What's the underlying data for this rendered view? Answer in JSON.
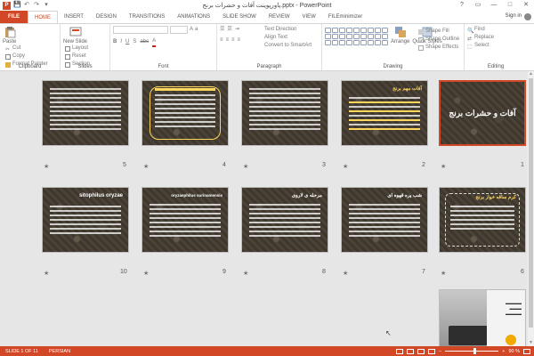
{
  "window": {
    "title": "پاورپوینت آفات و حشرات برنج.pptx - PowerPoint",
    "controls": [
      "?",
      "▭",
      "—",
      "□",
      "✕"
    ]
  },
  "qat": {
    "logo": "P",
    "save": "💾",
    "undo": "↶",
    "redo": "↷",
    "customize": "▾"
  },
  "tabs": [
    "FILE",
    "HOME",
    "INSERT",
    "DESIGN",
    "TRANSITIONS",
    "ANIMATIONS",
    "SLIDE SHOW",
    "REVIEW",
    "VIEW",
    "FILEminimizer"
  ],
  "active_tab": "HOME",
  "signin": "Sign in",
  "ribbon": {
    "clipboard": {
      "label": "Clipboard",
      "paste": "Paste",
      "cut": "Cut",
      "copy": "Copy",
      "format_painter": "Format Painter"
    },
    "slides": {
      "label": "Slides",
      "new_slide": "New Slide",
      "layout": "Layout",
      "reset": "Reset",
      "section": "Section"
    },
    "font": {
      "label": "Font"
    },
    "paragraph": {
      "label": "Paragraph",
      "text_direction": "Text Direction",
      "align_text": "Align Text",
      "convert": "Convert to SmartArt"
    },
    "drawing": {
      "label": "Drawing",
      "arrange": "Arrange",
      "quick_styles": "Quick Styles",
      "shape_fill": "Shape Fill",
      "shape_outline": "Shape Outline",
      "shape_effects": "Shape Effects"
    },
    "editing": {
      "label": "Editing",
      "find": "Find",
      "replace": "Replace",
      "select": "Select"
    }
  },
  "slides": [
    {
      "num": "1",
      "title": "آفات و حشرات برنج",
      "kind": "title"
    },
    {
      "num": "2",
      "title": "آفات مهم برنج",
      "kind": "list"
    },
    {
      "num": "3",
      "title": "",
      "kind": "text"
    },
    {
      "num": "4",
      "title": "",
      "kind": "frame"
    },
    {
      "num": "5",
      "title": "",
      "kind": "text"
    },
    {
      "num": "6",
      "title": "کرم ساقه خوار برنج",
      "kind": "dash"
    },
    {
      "num": "7",
      "title": "شب پره قهوه ای",
      "kind": "text"
    },
    {
      "num": "8",
      "title": "مرحله ی لاروی",
      "kind": "text"
    },
    {
      "num": "9",
      "title": "oryzaephilus surinamensis",
      "kind": "text"
    },
    {
      "num": "10",
      "title": "sitophilus oryzae",
      "kind": "text"
    },
    {
      "num": "",
      "title": "",
      "kind": "photo"
    }
  ],
  "status": {
    "slide": "SLIDE 1 OF 11",
    "lang": "PERSIAN",
    "zoom": "90 %",
    "zoom_level": 0.55
  }
}
